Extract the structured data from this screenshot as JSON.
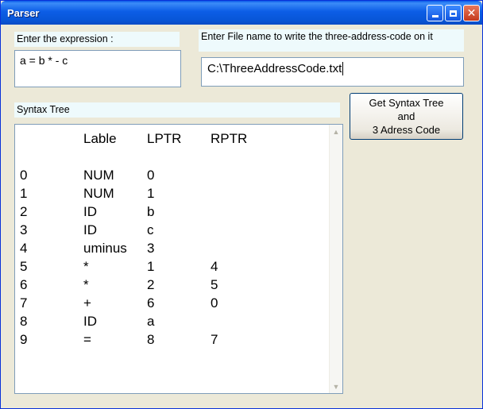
{
  "window": {
    "title": "Parser"
  },
  "expression": {
    "label": "Enter the expression :",
    "value": "a = b * - c"
  },
  "file": {
    "label": "Enter File name to write the three-address-code on it",
    "value": "C:\\ThreeAddressCode.txt"
  },
  "button": {
    "line1": "Get Syntax Tree",
    "line2": "and",
    "line3": "3 Adress Code"
  },
  "syntax_tree": {
    "label": "Syntax Tree",
    "headers": {
      "node": "",
      "lable": "Lable",
      "lptr": "LPTR",
      "rptr": "RPTR"
    },
    "rows": [
      {
        "node": "0",
        "lable": "NUM",
        "lptr": "0",
        "rptr": ""
      },
      {
        "node": "1",
        "lable": "NUM",
        "lptr": "1",
        "rptr": ""
      },
      {
        "node": "2",
        "lable": "ID",
        "lptr": "b",
        "rptr": ""
      },
      {
        "node": "3",
        "lable": "ID",
        "lptr": "c",
        "rptr": ""
      },
      {
        "node": "4",
        "lable": "uminus",
        "lptr": "3",
        "rptr": ""
      },
      {
        "node": "5",
        "lable": "*",
        "lptr": "1",
        "rptr": "4"
      },
      {
        "node": "6",
        "lable": "*",
        "lptr": "2",
        "rptr": "5"
      },
      {
        "node": "7",
        "lable": "+",
        "lptr": "6",
        "rptr": "0"
      },
      {
        "node": "8",
        "lable": "ID",
        "lptr": "a",
        "rptr": ""
      },
      {
        "node": "9",
        "lable": "=",
        "lptr": "8",
        "rptr": "7"
      }
    ]
  },
  "icons": {
    "minimize": "minimize-icon",
    "maximize": "maximize-icon",
    "close": "close-icon"
  }
}
